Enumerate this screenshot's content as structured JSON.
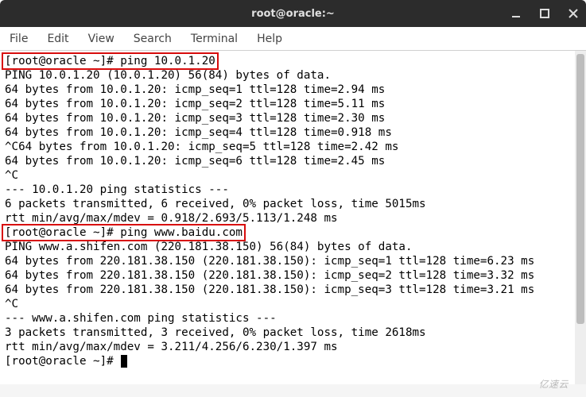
{
  "window": {
    "title": "root@oracle:~"
  },
  "menu": {
    "file": "File",
    "edit": "Edit",
    "view": "View",
    "search": "Search",
    "terminal": "Terminal",
    "help": "Help"
  },
  "terminal": {
    "lines": [
      "[root@oracle ~]# ping 10.0.1.20",
      "PING 10.0.1.20 (10.0.1.20) 56(84) bytes of data.",
      "64 bytes from 10.0.1.20: icmp_seq=1 ttl=128 time=2.94 ms",
      "64 bytes from 10.0.1.20: icmp_seq=2 ttl=128 time=5.11 ms",
      "64 bytes from 10.0.1.20: icmp_seq=3 ttl=128 time=2.30 ms",
      "64 bytes from 10.0.1.20: icmp_seq=4 ttl=128 time=0.918 ms",
      "^C64 bytes from 10.0.1.20: icmp_seq=5 ttl=128 time=2.42 ms",
      "64 bytes from 10.0.1.20: icmp_seq=6 ttl=128 time=2.45 ms",
      "^C",
      "--- 10.0.1.20 ping statistics ---",
      "6 packets transmitted, 6 received, 0% packet loss, time 5015ms",
      "rtt min/avg/max/mdev = 0.918/2.693/5.113/1.248 ms",
      "[root@oracle ~]# ping www.baidu.com",
      "PING www.a.shifen.com (220.181.38.150) 56(84) bytes of data.",
      "64 bytes from 220.181.38.150 (220.181.38.150): icmp_seq=1 ttl=128 time=6.23 ms",
      "64 bytes from 220.181.38.150 (220.181.38.150): icmp_seq=2 ttl=128 time=3.32 ms",
      "64 bytes from 220.181.38.150 (220.181.38.150): icmp_seq=3 ttl=128 time=3.21 ms",
      "^C",
      "--- www.a.shifen.com ping statistics ---",
      "3 packets transmitted, 3 received, 0% packet loss, time 2618ms",
      "rtt min/avg/max/mdev = 3.211/4.256/6.230/1.397 ms",
      "[root@oracle ~]# "
    ],
    "highlight_indices": [
      0,
      12
    ]
  },
  "watermark": "亿速云"
}
